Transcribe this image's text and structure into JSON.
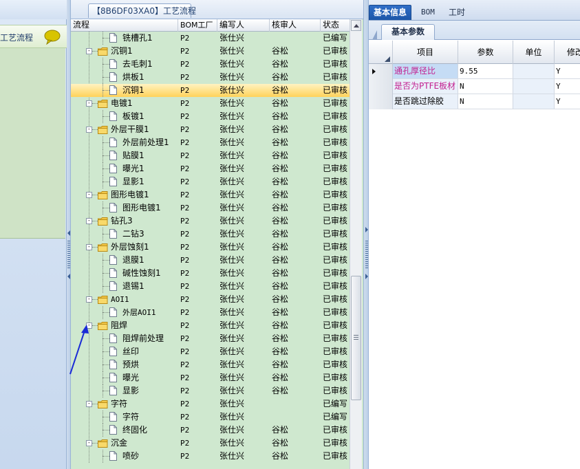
{
  "window": {
    "order_tab": "【8B6DF03XA0】工艺流程"
  },
  "left_panel": {
    "nav_item_label": "工艺流程",
    "nav_icon": "chat-bubble-icon"
  },
  "tree_grid": {
    "columns": [
      "流程",
      "BOM工厂",
      "编写人",
      "核审人",
      "状态"
    ],
    "rows": [
      {
        "level": 1,
        "kind": "doc",
        "name": "铣槽孔1",
        "bom": "P2",
        "writer": "张仕兴",
        "reviewer": "",
        "status": "已编写"
      },
      {
        "level": 0,
        "kind": "folder",
        "name": "沉铜1",
        "bom": "P2",
        "writer": "张仕兴",
        "reviewer": "谷松",
        "status": "已审核"
      },
      {
        "level": 1,
        "kind": "doc",
        "name": "去毛刺1",
        "bom": "P2",
        "writer": "张仕兴",
        "reviewer": "谷松",
        "status": "已审核"
      },
      {
        "level": 1,
        "kind": "doc",
        "name": "烘板1",
        "bom": "P2",
        "writer": "张仕兴",
        "reviewer": "谷松",
        "status": "已审核"
      },
      {
        "level": 1,
        "kind": "doc",
        "name": "沉铜1",
        "bom": "P2",
        "writer": "张仕兴",
        "reviewer": "谷松",
        "status": "已审核",
        "selected": true
      },
      {
        "level": 0,
        "kind": "folder",
        "name": "电镀1",
        "bom": "P2",
        "writer": "张仕兴",
        "reviewer": "谷松",
        "status": "已审核"
      },
      {
        "level": 1,
        "kind": "doc",
        "name": "板镀1",
        "bom": "P2",
        "writer": "张仕兴",
        "reviewer": "谷松",
        "status": "已审核"
      },
      {
        "level": 0,
        "kind": "folder",
        "name": "外层干膜1",
        "bom": "P2",
        "writer": "张仕兴",
        "reviewer": "谷松",
        "status": "已审核"
      },
      {
        "level": 1,
        "kind": "doc",
        "name": "外层前处理1",
        "bom": "P2",
        "writer": "张仕兴",
        "reviewer": "谷松",
        "status": "已审核"
      },
      {
        "level": 1,
        "kind": "doc",
        "name": "贴膜1",
        "bom": "P2",
        "writer": "张仕兴",
        "reviewer": "谷松",
        "status": "已审核"
      },
      {
        "level": 1,
        "kind": "doc",
        "name": "曝光1",
        "bom": "P2",
        "writer": "张仕兴",
        "reviewer": "谷松",
        "status": "已审核"
      },
      {
        "level": 1,
        "kind": "doc",
        "name": "显影1",
        "bom": "P2",
        "writer": "张仕兴",
        "reviewer": "谷松",
        "status": "已审核"
      },
      {
        "level": 0,
        "kind": "folder",
        "name": "图形电镀1",
        "bom": "P2",
        "writer": "张仕兴",
        "reviewer": "谷松",
        "status": "已审核"
      },
      {
        "level": 1,
        "kind": "doc",
        "name": "图形电镀1",
        "bom": "P2",
        "writer": "张仕兴",
        "reviewer": "谷松",
        "status": "已审核"
      },
      {
        "level": 0,
        "kind": "folder",
        "name": "钻孔3",
        "bom": "P2",
        "writer": "张仕兴",
        "reviewer": "谷松",
        "status": "已审核"
      },
      {
        "level": 1,
        "kind": "doc",
        "name": "二钻3",
        "bom": "P2",
        "writer": "张仕兴",
        "reviewer": "谷松",
        "status": "已审核"
      },
      {
        "level": 0,
        "kind": "folder",
        "name": "外层蚀刻1",
        "bom": "P2",
        "writer": "张仕兴",
        "reviewer": "谷松",
        "status": "已审核"
      },
      {
        "level": 1,
        "kind": "doc",
        "name": "退膜1",
        "bom": "P2",
        "writer": "张仕兴",
        "reviewer": "谷松",
        "status": "已审核"
      },
      {
        "level": 1,
        "kind": "doc",
        "name": "碱性蚀刻1",
        "bom": "P2",
        "writer": "张仕兴",
        "reviewer": "谷松",
        "status": "已审核"
      },
      {
        "level": 1,
        "kind": "doc",
        "name": "退锡1",
        "bom": "P2",
        "writer": "张仕兴",
        "reviewer": "谷松",
        "status": "已审核"
      },
      {
        "level": 0,
        "kind": "folder",
        "name": "AOI1",
        "bom": "P2",
        "writer": "张仕兴",
        "reviewer": "谷松",
        "status": "已审核"
      },
      {
        "level": 1,
        "kind": "doc",
        "name": "外层AOI1",
        "bom": "P2",
        "writer": "张仕兴",
        "reviewer": "谷松",
        "status": "已审核"
      },
      {
        "level": 0,
        "kind": "folder",
        "name": "阻焊",
        "bom": "P2",
        "writer": "张仕兴",
        "reviewer": "谷松",
        "status": "已审核"
      },
      {
        "level": 1,
        "kind": "doc",
        "name": "阻焊前处理",
        "bom": "P2",
        "writer": "张仕兴",
        "reviewer": "谷松",
        "status": "已审核"
      },
      {
        "level": 1,
        "kind": "doc",
        "name": "丝印",
        "bom": "P2",
        "writer": "张仕兴",
        "reviewer": "谷松",
        "status": "已审核"
      },
      {
        "level": 1,
        "kind": "doc",
        "name": "预烘",
        "bom": "P2",
        "writer": "张仕兴",
        "reviewer": "谷松",
        "status": "已审核"
      },
      {
        "level": 1,
        "kind": "doc",
        "name": "曝光",
        "bom": "P2",
        "writer": "张仕兴",
        "reviewer": "谷松",
        "status": "已审核"
      },
      {
        "level": 1,
        "kind": "doc",
        "name": "显影",
        "bom": "P2",
        "writer": "张仕兴",
        "reviewer": "谷松",
        "status": "已审核"
      },
      {
        "level": 0,
        "kind": "folder",
        "name": "字符",
        "bom": "P2",
        "writer": "张仕兴",
        "reviewer": "",
        "status": "已编写"
      },
      {
        "level": 1,
        "kind": "doc",
        "name": "字符",
        "bom": "P2",
        "writer": "张仕兴",
        "reviewer": "",
        "status": "已编写"
      },
      {
        "level": 1,
        "kind": "doc",
        "name": "终固化",
        "bom": "P2",
        "writer": "张仕兴",
        "reviewer": "谷松",
        "status": "已审核"
      },
      {
        "level": 0,
        "kind": "folder",
        "name": "沉金",
        "bom": "P2",
        "writer": "张仕兴",
        "reviewer": "谷松",
        "status": "已审核"
      },
      {
        "level": 1,
        "kind": "doc",
        "name": "喷砂",
        "bom": "P2",
        "writer": "张仕兴",
        "reviewer": "谷松",
        "status": "已审核"
      }
    ]
  },
  "right_panel": {
    "tabs": [
      "基本信息",
      "BOM",
      "工时"
    ],
    "subtab": "基本参数",
    "param_columns": [
      "项目",
      "参数",
      "单位",
      "修改"
    ],
    "params": [
      {
        "item": "通孔厚径比",
        "value": "9.55",
        "unit": "",
        "modify": "Y",
        "magenta": true,
        "current": true
      },
      {
        "item": "是否为PTFE板材",
        "value": "N",
        "unit": "",
        "modify": "Y",
        "magenta": true,
        "current": false
      },
      {
        "item": "是否跳过除胶",
        "value": "N",
        "unit": "",
        "modify": "Y",
        "magenta": false,
        "current": false
      }
    ]
  },
  "colors": {
    "grid_background": "#cfe8cf",
    "selected_row": "#ffd25a",
    "active_tab": "#1c56a8",
    "magenta_text": "#c21d8f",
    "annotation_arrow": "#1a2bd6"
  }
}
